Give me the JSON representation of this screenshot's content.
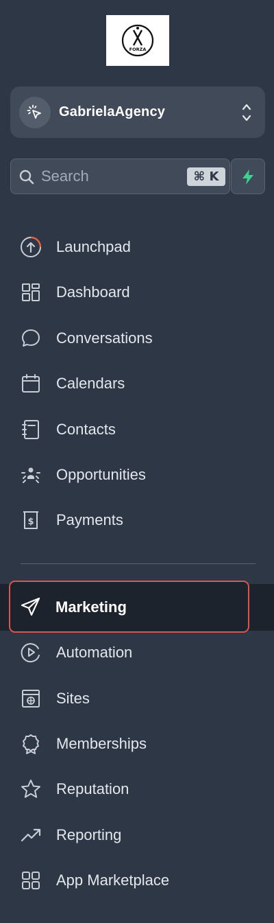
{
  "logo": {
    "icon": "forza-logo",
    "text": "FORZA"
  },
  "account": {
    "name": "GabrielaAgency",
    "icon": "cursor-click-icon"
  },
  "search": {
    "placeholder": "Search",
    "shortcut": "⌘ K"
  },
  "quick_action": {
    "icon": "bolt-icon",
    "color": "#3fcf8e"
  },
  "nav": {
    "primary": [
      {
        "label": "Launchpad",
        "icon": "launchpad-icon"
      },
      {
        "label": "Dashboard",
        "icon": "dashboard-grid-icon"
      },
      {
        "label": "Conversations",
        "icon": "chat-bubble-icon"
      },
      {
        "label": "Calendars",
        "icon": "calendar-icon"
      },
      {
        "label": "Contacts",
        "icon": "contact-book-icon"
      },
      {
        "label": "Opportunities",
        "icon": "opportunities-icon"
      },
      {
        "label": "Payments",
        "icon": "payments-icon"
      }
    ],
    "secondary": [
      {
        "label": "Marketing",
        "icon": "send-icon",
        "active": true
      },
      {
        "label": "Automation",
        "icon": "automation-icon"
      },
      {
        "label": "Sites",
        "icon": "sites-icon"
      },
      {
        "label": "Memberships",
        "icon": "award-icon"
      },
      {
        "label": "Reputation",
        "icon": "star-icon"
      },
      {
        "label": "Reporting",
        "icon": "trending-up-icon"
      },
      {
        "label": "App Marketplace",
        "icon": "apps-grid-icon"
      }
    ]
  },
  "colors": {
    "background": "#2e3746",
    "active_background": "#1d232d",
    "highlight_border": "#d9574b",
    "launchpad_accent": "#e0603f"
  }
}
